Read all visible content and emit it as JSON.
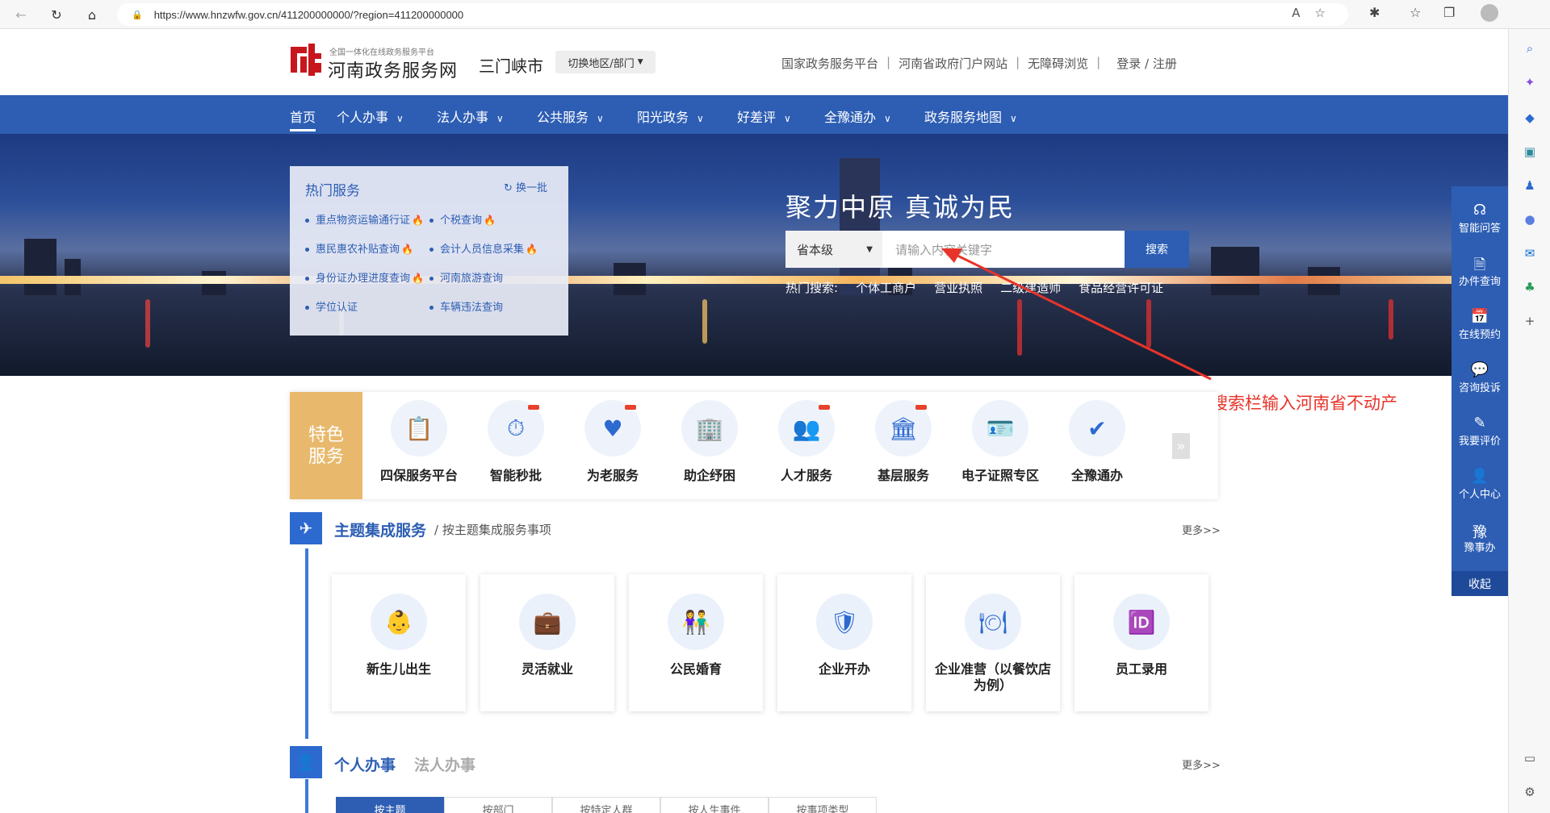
{
  "browser": {
    "url": "https://www.hnzwfw.gov.cn/411200000000/?region=411200000000"
  },
  "header": {
    "logo_small": "全国一体化在线政务服务平台",
    "logo_title": "河南政务服务网",
    "city": "三门峡市",
    "switch_label": "切换地区/部门",
    "links": [
      "国家政务服务平台",
      "河南省政府门户网站",
      "无障碍浏览",
      "登录 / 注册"
    ]
  },
  "nav": {
    "items": [
      "首页",
      "个人办事",
      "法人办事",
      "公共服务",
      "阳光政务",
      "好差评",
      "全豫通办",
      "政务服务地图"
    ]
  },
  "hot_services": {
    "title": "热门服务",
    "refresh": "换一批",
    "items": [
      {
        "label": "重点物资运输通行证",
        "hot": true
      },
      {
        "label": "个税查询",
        "hot": true
      },
      {
        "label": "惠民惠农补贴查询",
        "hot": true
      },
      {
        "label": "会计人员信息采集",
        "hot": true
      },
      {
        "label": "身份证办理进度查询",
        "hot": true
      },
      {
        "label": "河南旅游查询",
        "hot": false
      },
      {
        "label": "学位认证",
        "hot": false
      },
      {
        "label": "车辆违法查询",
        "hot": false
      }
    ]
  },
  "search": {
    "slogan": "聚力中原  真诚为民",
    "level": "省本级",
    "placeholder": "请输入内容关键字",
    "button": "搜索",
    "hot_label": "热门搜索:",
    "hot_terms": [
      "个体工商户",
      "营业执照",
      "二级建造师",
      "食品经营许可证"
    ]
  },
  "annotation": "搜索栏输入河南省不动产",
  "features": {
    "badge": "特色服务",
    "items": [
      "四保服务平台",
      "智能秒批",
      "为老服务",
      "助企纾困",
      "人才服务",
      "基层服务",
      "电子证照专区",
      "全豫通办"
    ]
  },
  "theme_section": {
    "title": "主题集成服务",
    "subtitle": "/ 按主题集成服务事项",
    "more": "更多>>",
    "cards": [
      "新生儿出生",
      "灵活就业",
      "公民婚育",
      "企业开办",
      "企业准营（以餐饮店为例）",
      "员工录用"
    ]
  },
  "personal_section": {
    "title": "个人办事",
    "title2": "法人办事",
    "more": "更多>>",
    "tabs": [
      "按主题",
      "按部门",
      "按特定人群",
      "按人生事件",
      "按事项类型"
    ]
  },
  "float_panel": {
    "items": [
      "智能问答",
      "办件查询",
      "在线预约",
      "咨询投诉",
      "我要评价",
      "个人中心",
      "豫事办"
    ],
    "collapse": "收起"
  },
  "colors": {
    "primary": "#2d5eb4",
    "accent_gold": "#e8b96c",
    "annotation_red": "#e8332a"
  }
}
